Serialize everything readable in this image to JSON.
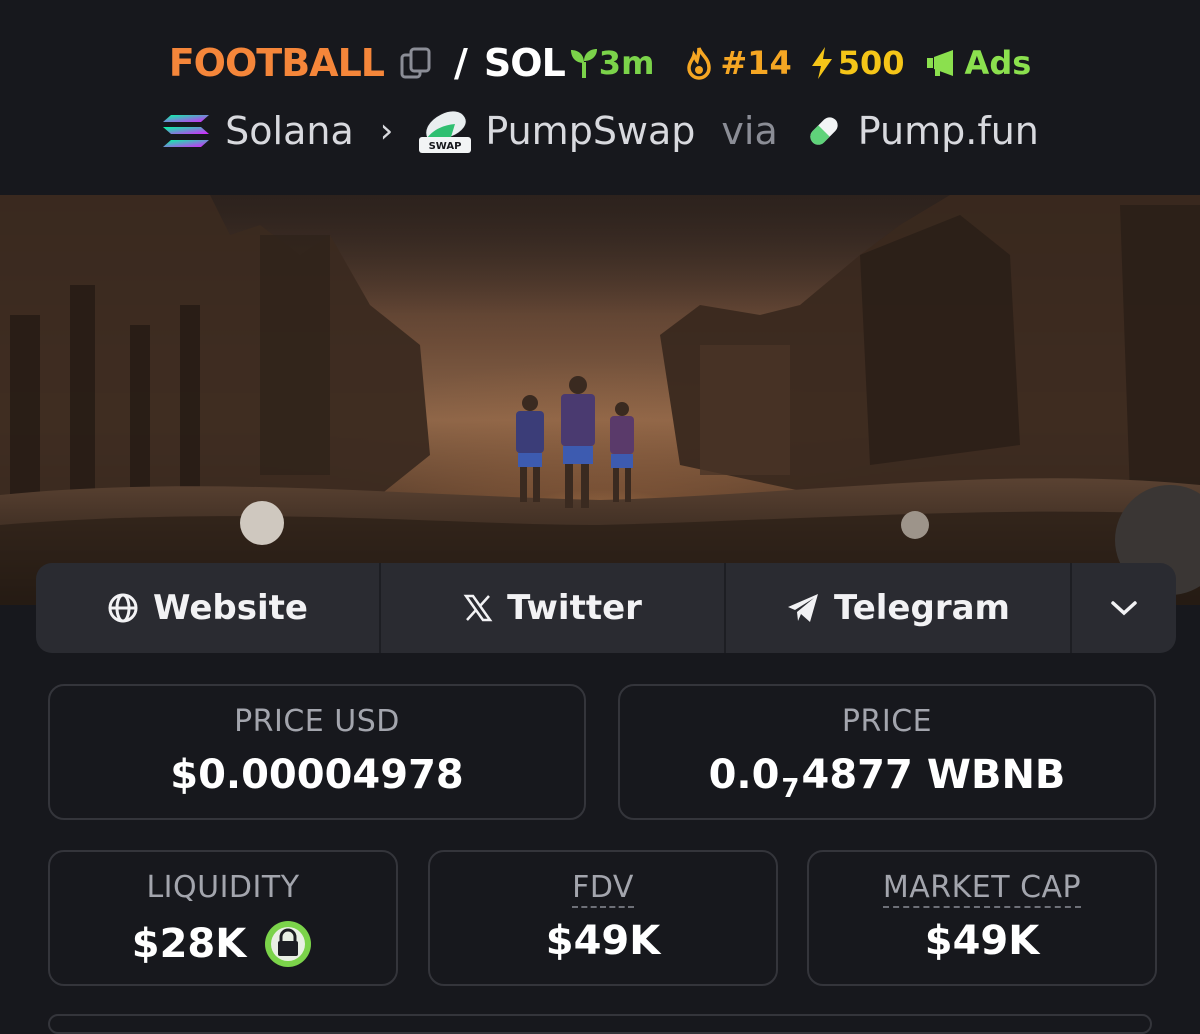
{
  "header": {
    "base_token": "FOOTBALL",
    "separator": "/",
    "quote_token": "SOL",
    "age": "3m",
    "rank": "#14",
    "boosts": "500",
    "ads_label": "Ads",
    "chain": "Solana",
    "dex": "PumpSwap",
    "via_label": "via",
    "launchpad": "Pump.fun",
    "dex_badge": "SWAP",
    "colors": {
      "base": "#f5863a",
      "age": "#7bd34a",
      "rank": "#f5a623",
      "boost": "#f5c518",
      "ads": "#8be04e"
    }
  },
  "socials": {
    "website": "Website",
    "twitter": "Twitter",
    "telegram": "Telegram"
  },
  "stats": {
    "price_usd_label": "PRICE USD",
    "price_usd_value": "$0.00004978",
    "price_label": "PRICE",
    "price_prefix": "0.0",
    "price_zeros": "7",
    "price_digits": "4877",
    "price_unit": "WBNB",
    "liquidity_label": "LIQUIDITY",
    "liquidity_value": "$28K",
    "fdv_label": "FDV",
    "fdv_value": "$49K",
    "mcap_label": "MARKET CAP",
    "mcap_value": "$49K"
  }
}
